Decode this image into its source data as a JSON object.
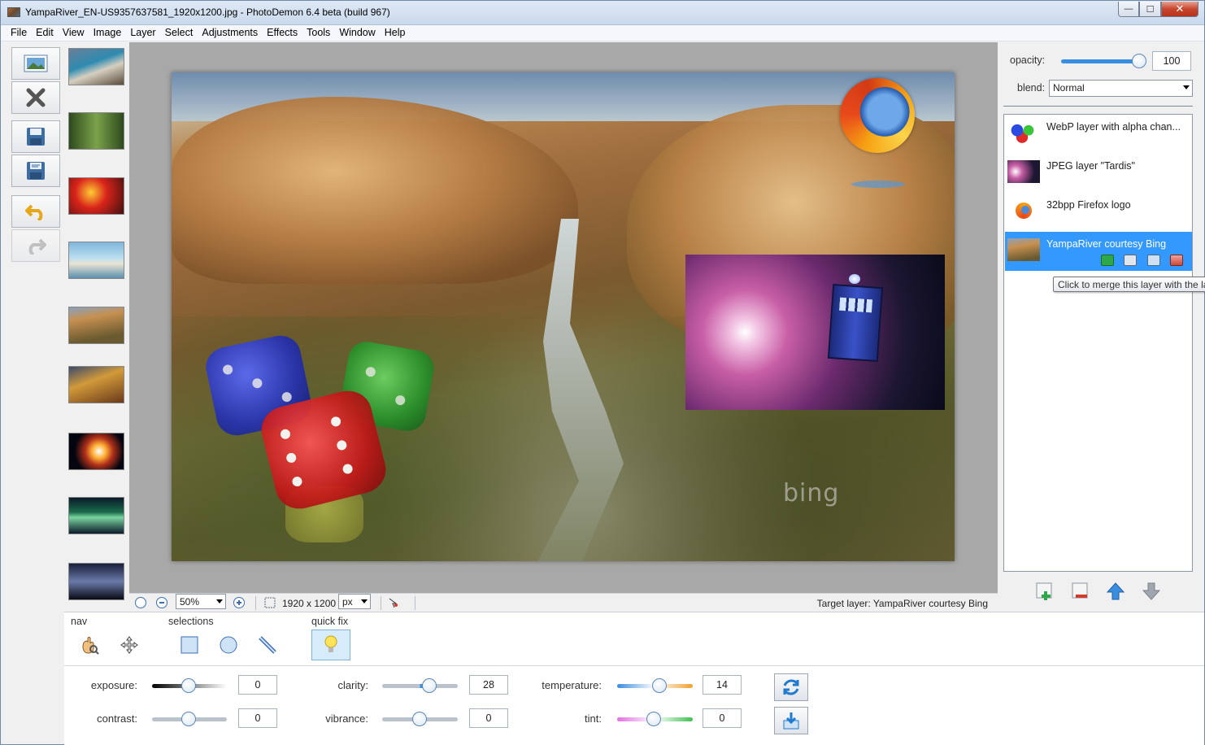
{
  "window": {
    "title": "YampaRiver_EN-US9357637581_1920x1200.jpg  -  PhotoDemon 6.4 beta (build 967)",
    "close_label": "✕",
    "min_label": "—",
    "max_label": "☐"
  },
  "menu": [
    "File",
    "Edit",
    "View",
    "Image",
    "Layer",
    "Select",
    "Adjustments",
    "Effects",
    "Tools",
    "Window",
    "Help"
  ],
  "image_overlay": {
    "watermark": "bing"
  },
  "statusbar": {
    "zoom": "50%",
    "dimensions": "1920 x 1200",
    "unit": "px",
    "target_layer": "Target layer: YampaRiver courtesy Bing"
  },
  "layers_panel": {
    "opacity_label": "opacity:",
    "opacity_value": "100",
    "opacity_fraction": 1.0,
    "blend_label": "blend:",
    "blend_value": "Normal",
    "layers": [
      {
        "name": "WebP layer with alpha chan...",
        "thumb": "dice"
      },
      {
        "name": "JPEG layer \"Tardis\"",
        "thumb": "tardis"
      },
      {
        "name": "32bpp Firefox logo",
        "thumb": "firefox"
      },
      {
        "name": "YampaRiver courtesy Bing",
        "thumb": "river",
        "active": true
      }
    ],
    "tooltip": "Click to merge this layer with the layer beneath it"
  },
  "bottom": {
    "nav_label": "nav",
    "selections_label": "selections",
    "quickfix_label": "quick fix",
    "adjustments": {
      "exposure": {
        "label": "exposure:",
        "value": "0"
      },
      "clarity": {
        "label": "clarity:",
        "value": "28"
      },
      "temperature": {
        "label": "temperature:",
        "value": "14"
      },
      "contrast": {
        "label": "contrast:",
        "value": "0"
      },
      "vibrance": {
        "label": "vibrance:",
        "value": "0"
      },
      "tint": {
        "label": "tint:",
        "value": "0"
      }
    }
  },
  "colors": {
    "accent": "#3399ff",
    "canvas_bg": "#a8a8a8"
  }
}
